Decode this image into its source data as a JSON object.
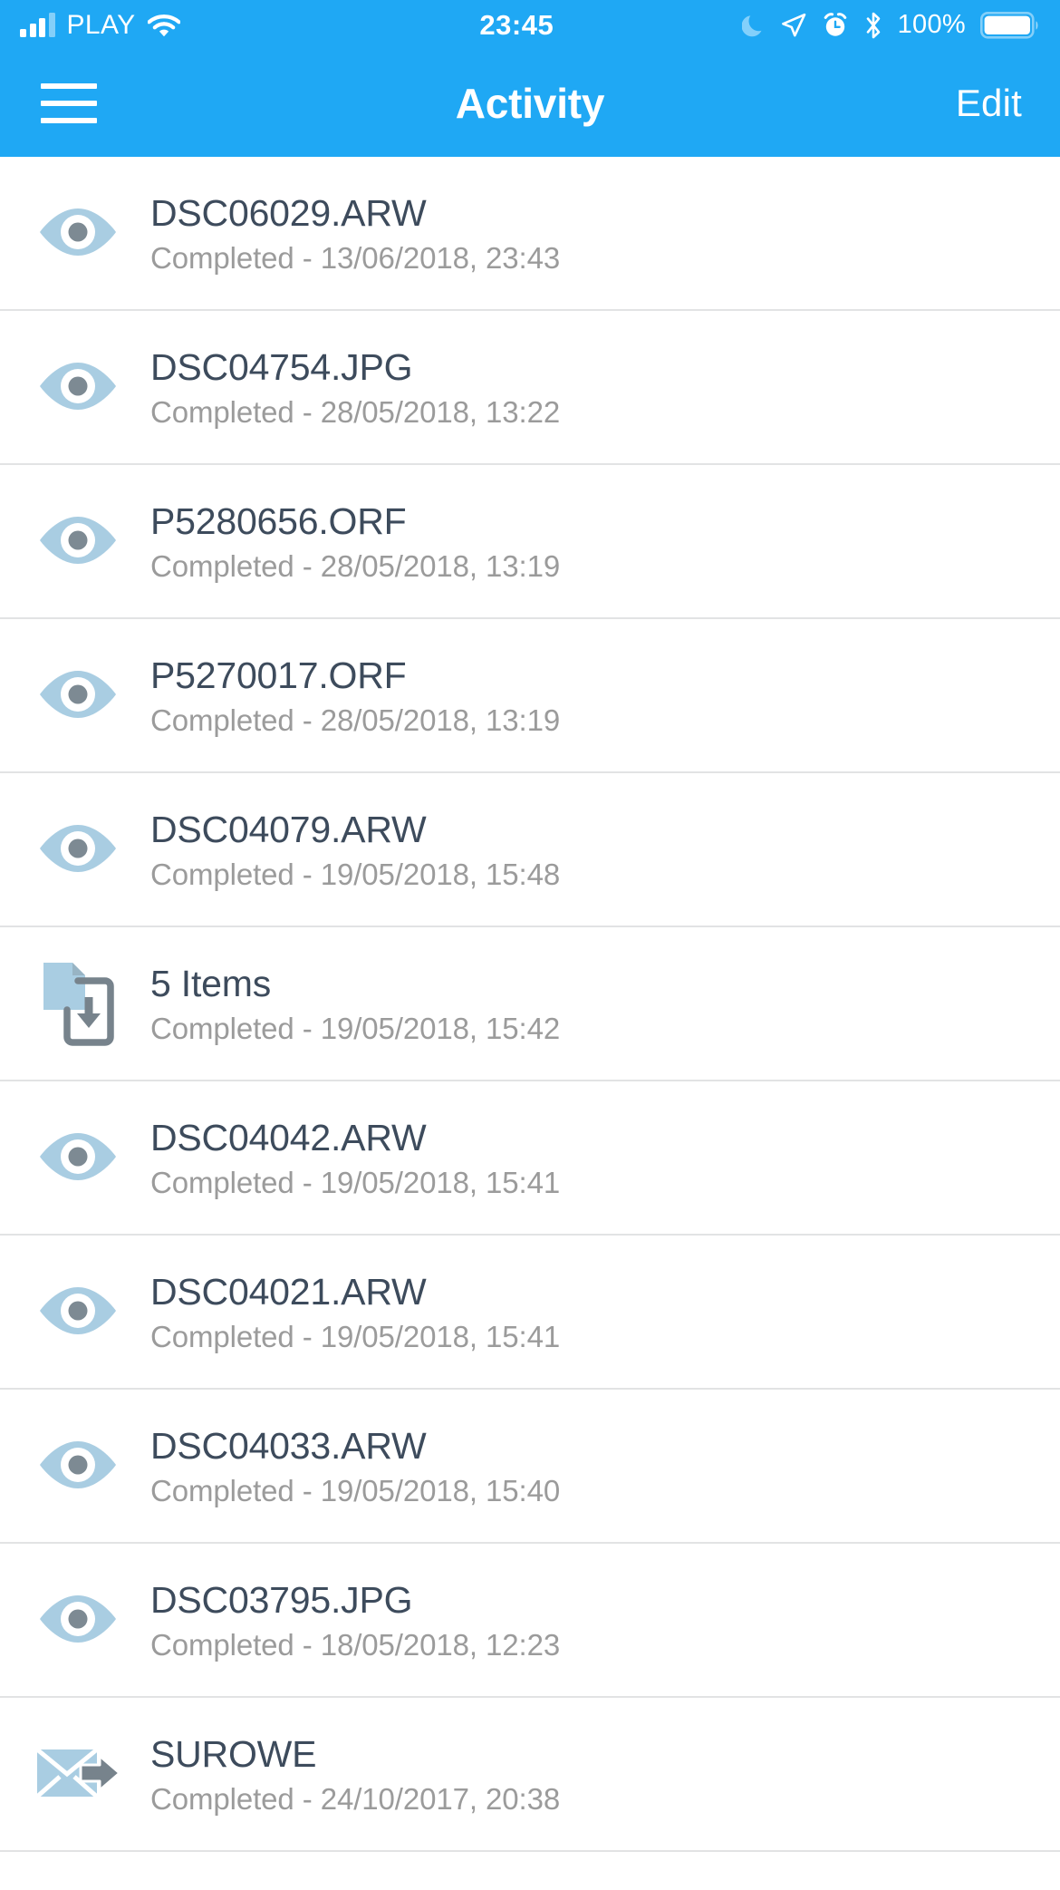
{
  "colors": {
    "nav_blue": "#1fa8f4",
    "title_text": "#3d4b5c",
    "subtitle_text": "#9b9b9b",
    "icon_blue": "#a9cde2",
    "icon_gray": "#77838c",
    "divider": "#e2e3e4"
  },
  "status_bar": {
    "carrier": "PLAY",
    "signal_icon": "signal-bars-icon",
    "wifi_icon": "wifi-icon",
    "time": "23:45",
    "dnd_icon": "moon-do-not-disturb-icon",
    "location_icon": "location-arrow-icon",
    "alarm_icon": "alarm-clock-icon",
    "bluetooth_icon": "bluetooth-icon",
    "battery_percent": "100%",
    "battery_icon": "battery-full-icon"
  },
  "nav_bar": {
    "menu_icon": "hamburger-menu-icon",
    "title": "Activity",
    "edit_label": "Edit"
  },
  "activity": {
    "rows": [
      {
        "icon": "eye-icon",
        "title": "DSC06029.ARW",
        "subtitle": "Completed - 13/06/2018, 23:43"
      },
      {
        "icon": "eye-icon",
        "title": "DSC04754.JPG",
        "subtitle": "Completed - 28/05/2018, 13:22"
      },
      {
        "icon": "eye-icon",
        "title": "P5280656.ORF",
        "subtitle": "Completed - 28/05/2018, 13:19"
      },
      {
        "icon": "eye-icon",
        "title": "P5270017.ORF",
        "subtitle": "Completed - 28/05/2018, 13:19"
      },
      {
        "icon": "eye-icon",
        "title": "DSC04079.ARW",
        "subtitle": "Completed - 19/05/2018, 15:48"
      },
      {
        "icon": "download-to-device-icon",
        "title": "5 Items",
        "subtitle": "Completed - 19/05/2018, 15:42"
      },
      {
        "icon": "eye-icon",
        "title": "DSC04042.ARW",
        "subtitle": "Completed - 19/05/2018, 15:41"
      },
      {
        "icon": "eye-icon",
        "title": "DSC04021.ARW",
        "subtitle": "Completed - 19/05/2018, 15:41"
      },
      {
        "icon": "eye-icon",
        "title": "DSC04033.ARW",
        "subtitle": "Completed - 19/05/2018, 15:40"
      },
      {
        "icon": "eye-icon",
        "title": "DSC03795.JPG",
        "subtitle": "Completed - 18/05/2018, 12:23"
      },
      {
        "icon": "send-envelope-icon",
        "title": "SUROWE",
        "subtitle": "Completed - 24/10/2017, 20:38"
      }
    ]
  }
}
